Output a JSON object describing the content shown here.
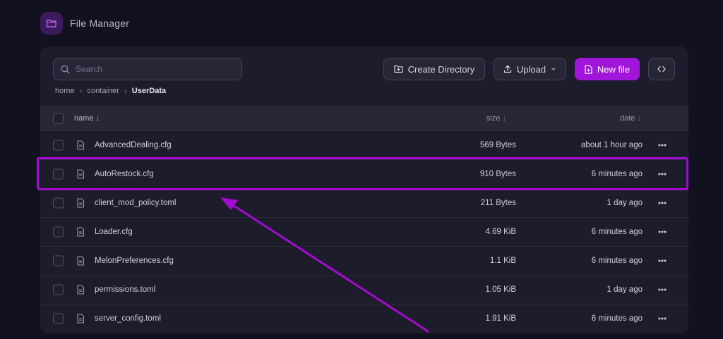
{
  "app": {
    "title": "File Manager",
    "logo_icon": "folder-icon",
    "accent": "#a114d9"
  },
  "toolbar": {
    "search_placeholder": "Search",
    "create_directory_label": "Create Directory",
    "upload_label": "Upload",
    "new_file_label": "New file"
  },
  "breadcrumb": {
    "items": [
      "home",
      "container"
    ],
    "current": "UserData"
  },
  "table": {
    "columns": {
      "name": "name",
      "size": "size",
      "date": "date"
    },
    "rows": [
      {
        "name": "AdvancedDealing.cfg",
        "size": "569 Bytes",
        "date": "about 1 hour ago"
      },
      {
        "name": "AutoRestock.cfg",
        "size": "910 Bytes",
        "date": "6 minutes ago"
      },
      {
        "name": "client_mod_policy.toml",
        "size": "211 Bytes",
        "date": "1 day ago"
      },
      {
        "name": "Loader.cfg",
        "size": "4.69 KiB",
        "date": "6 minutes ago"
      },
      {
        "name": "MelonPreferences.cfg",
        "size": "1.1 KiB",
        "date": "6 minutes ago"
      },
      {
        "name": "permissions.toml",
        "size": "1.05 KiB",
        "date": "1 day ago"
      },
      {
        "name": "server_config.toml",
        "size": "1.91 KiB",
        "date": "6 minutes ago"
      }
    ]
  },
  "annotation": {
    "highlight_color": "#a40bd0",
    "highlighted_row": "AutoRestock.cfg"
  }
}
